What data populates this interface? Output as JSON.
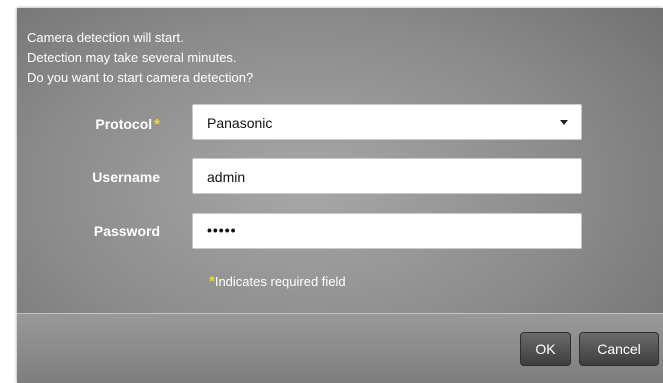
{
  "dialog": {
    "messages": [
      "Camera detection will start.",
      "Detection may take several minutes.",
      "Do you want to start camera detection?"
    ]
  },
  "form": {
    "protocol": {
      "label": "Protocol",
      "required_mark": "*",
      "value": "Panasonic"
    },
    "username": {
      "label": "Username",
      "value": "admin"
    },
    "password": {
      "label": "Password",
      "value": "•••••"
    }
  },
  "note": {
    "mark": "*",
    "text": "Indicates required field"
  },
  "buttons": {
    "ok": "OK",
    "cancel": "Cancel"
  },
  "colors": {
    "required_star": "#f3dc24",
    "button_dark": "#4a4a4a"
  },
  "icons": {
    "protocol_dropdown": "chevron-down-icon"
  }
}
